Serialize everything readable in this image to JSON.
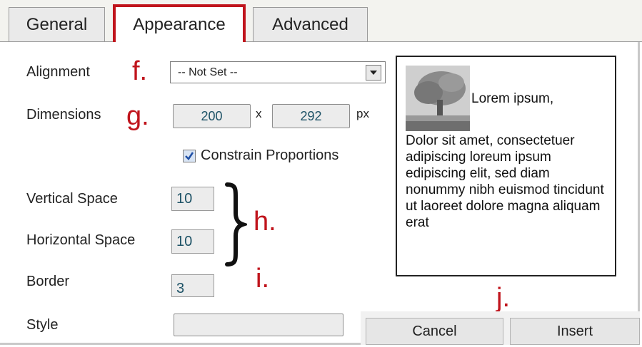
{
  "tabs": [
    {
      "label": "General"
    },
    {
      "label": "Appearance"
    },
    {
      "label": "Advanced"
    }
  ],
  "form": {
    "alignment_label": "Alignment",
    "alignment_value": "-- Not Set --",
    "dimensions_label": "Dimensions",
    "width": "200",
    "x_sep": "x",
    "height": "292",
    "unit": "px",
    "constrain_label": "Constrain Proportions",
    "constrain_checked": true,
    "vspace_label": "Vertical Space",
    "vspace_value": "10",
    "hspace_label": "Horizontal Space",
    "hspace_value": "10",
    "border_label": "Border",
    "border_value": "3",
    "style_label": "Style",
    "style_value": ""
  },
  "annotations": {
    "f": "f.",
    "g": "g.",
    "h": "h.",
    "i": "i.",
    "j": "j."
  },
  "preview": {
    "caption": "Lorem ipsum,",
    "body": "Dolor sit amet, consectetuer adipiscing loreum ipsum edipiscing elit, sed diam nonummy nibh euismod tincidunt ut laoreet dolore magna aliquam erat"
  },
  "buttons": {
    "cancel": "Cancel",
    "insert": "Insert"
  },
  "colors": {
    "accent_red": "#c0141c",
    "field_text": "#1d5266"
  }
}
